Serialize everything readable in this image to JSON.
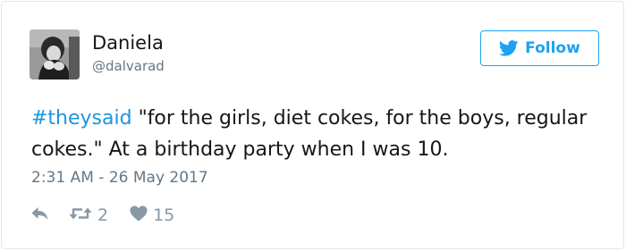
{
  "user": {
    "name": "Daniela",
    "handle": "@dalvarad"
  },
  "follow": {
    "label": "Follow",
    "icon": "twitter-bird-icon"
  },
  "tweet": {
    "hashtag": "#theysaid",
    "text": " \"for the girls, diet cokes, for the boys, regular cokes.\" At a birthday party when I was 10.",
    "timestamp": "2:31 AM - 26 May 2017"
  },
  "actions": {
    "reply_icon": "reply-icon",
    "retweet_icon": "retweet-icon",
    "retweet_count": "2",
    "like_icon": "heart-icon",
    "like_count": "15"
  },
  "colors": {
    "accent": "#1da1f2",
    "hashtag": "#1b95e0",
    "muted": "#657786",
    "icon": "#8899a6",
    "border": "#e1e8ed"
  }
}
